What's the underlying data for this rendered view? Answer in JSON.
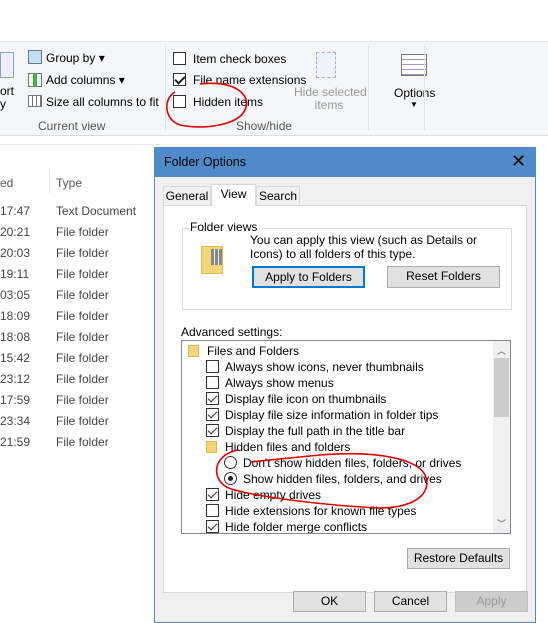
{
  "ribbon": {
    "sort_partial": [
      "ort",
      "y"
    ],
    "group_by": "Group by",
    "add_columns": "Add columns",
    "size_all": "Size all columns to fit",
    "current_view": "Current view",
    "item_check_boxes": "Item check boxes",
    "item_check_boxes_checked": false,
    "file_name_extensions": "File name extensions",
    "file_name_extensions_checked": true,
    "hidden_items": "Hidden items",
    "hidden_items_checked": false,
    "hide_selected": [
      "Hide selected",
      "items"
    ],
    "show_hide": "Show/hide",
    "options": "Options"
  },
  "list": {
    "columns": [
      "ed",
      "Type"
    ],
    "rows": [
      {
        "time": "17:47",
        "type": "Text Document"
      },
      {
        "time": "20:21",
        "type": "File folder"
      },
      {
        "time": "20:03",
        "type": "File folder"
      },
      {
        "time": "19:11",
        "type": "File folder"
      },
      {
        "time": "03:05",
        "type": "File folder"
      },
      {
        "time": "18:09",
        "type": "File folder"
      },
      {
        "time": "18:08",
        "type": "File folder"
      },
      {
        "time": "15:42",
        "type": "File folder"
      },
      {
        "time": "23:12",
        "type": "File folder"
      },
      {
        "time": "17:59",
        "type": "File folder"
      },
      {
        "time": "23:34",
        "type": "File folder"
      },
      {
        "time": "21:59",
        "type": "File folder"
      }
    ]
  },
  "dialog": {
    "title": "Folder Options",
    "tabs": [
      "General",
      "View",
      "Search"
    ],
    "active_tab": "View",
    "folder_views": "Folder views",
    "folder_views_text": "You can apply this view (such as Details or Icons) to all folders of this type.",
    "apply_to_folders": "Apply to Folders",
    "reset_folders": "Reset Folders",
    "advanced_settings": "Advanced settings:",
    "tree": [
      {
        "kind": "folder",
        "label": "Files and Folders",
        "level": 0
      },
      {
        "kind": "check",
        "label": "Always show icons, never thumbnails",
        "checked": false,
        "level": 1
      },
      {
        "kind": "check",
        "label": "Always show menus",
        "checked": false,
        "level": 1
      },
      {
        "kind": "check",
        "label": "Display file icon on thumbnails",
        "checked": true,
        "level": 1
      },
      {
        "kind": "check",
        "label": "Display file size information in folder tips",
        "checked": true,
        "level": 1
      },
      {
        "kind": "check",
        "label": "Display the full path in the title bar",
        "checked": true,
        "level": 1
      },
      {
        "kind": "folder",
        "label": "Hidden files and folders",
        "level": 1
      },
      {
        "kind": "radio",
        "label": "Don't show hidden files, folders, or drives",
        "checked": false,
        "level": 2
      },
      {
        "kind": "radio",
        "label": "Show hidden files, folders, and drives",
        "checked": true,
        "level": 2
      },
      {
        "kind": "check",
        "label": "Hide empty drives",
        "checked": true,
        "level": 1
      },
      {
        "kind": "check",
        "label": "Hide extensions for known file types",
        "checked": false,
        "level": 1
      },
      {
        "kind": "check",
        "label": "Hide folder merge conflicts",
        "checked": true,
        "level": 1
      }
    ],
    "restore_defaults": "Restore Defaults",
    "ok": "OK",
    "cancel": "Cancel",
    "apply": "Apply"
  },
  "colors": {
    "titlebar": "#4f8ac9",
    "annotation": "#e00000",
    "focus": "#0078d7"
  }
}
